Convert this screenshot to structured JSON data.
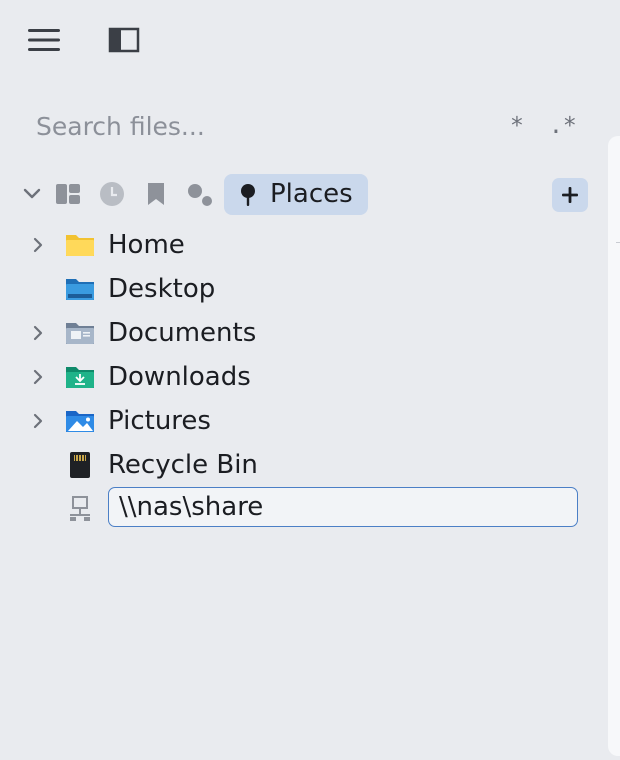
{
  "toolbar": {
    "menu_icon": "hamburger-menu-icon",
    "sidebar_icon": "sidebar-toggle-icon"
  },
  "search": {
    "placeholder": "Search files...",
    "value": "",
    "glob_label": "*",
    "regex_label": ".*"
  },
  "places_bar": {
    "icons": [
      "collapse-chevron-icon",
      "grid-view-icon",
      "recent-clock-icon",
      "bookmark-icon",
      "tags-icon"
    ],
    "active_tab": {
      "label": "Places",
      "icon": "pin-icon"
    },
    "add_label": "+"
  },
  "places": [
    {
      "label": "Home",
      "expandable": true,
      "icon": "home-folder-icon"
    },
    {
      "label": "Desktop",
      "expandable": false,
      "icon": "desktop-folder-icon"
    },
    {
      "label": "Documents",
      "expandable": true,
      "icon": "documents-folder-icon"
    },
    {
      "label": "Downloads",
      "expandable": true,
      "icon": "downloads-folder-icon"
    },
    {
      "label": "Pictures",
      "expandable": true,
      "icon": "pictures-folder-icon"
    },
    {
      "label": "Recycle Bin",
      "expandable": false,
      "icon": "recycle-bin-icon"
    }
  ],
  "new_entry": {
    "icon": "network-share-icon",
    "value": "\\\\nas\\share"
  },
  "colors": {
    "background": "#e9ebef",
    "accent": "#cad8ec",
    "focus_border": "#4b7fc6"
  }
}
